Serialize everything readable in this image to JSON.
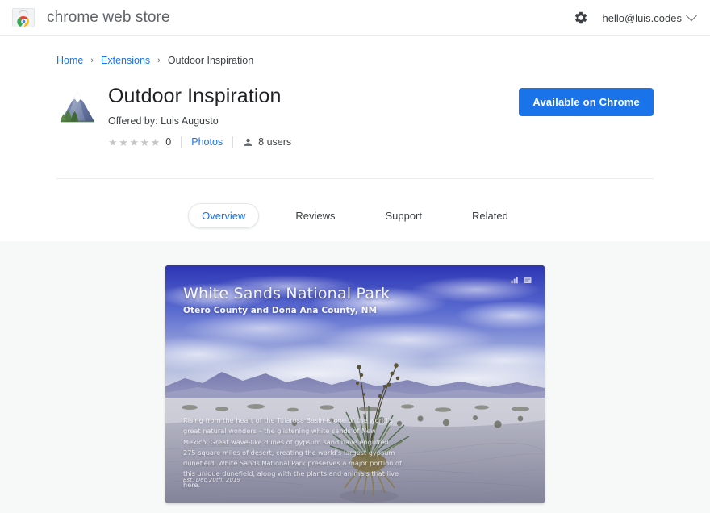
{
  "header": {
    "brand_title": "chrome web store",
    "logo_icon": "chrome-web-store-logo",
    "gear_icon": "gear-icon",
    "account_email": "hello@luis.codes",
    "chevron_icon": "chevron-down-icon"
  },
  "breadcrumb": {
    "items": [
      {
        "label": "Home",
        "link": true
      },
      {
        "label": "Extensions",
        "link": true
      },
      {
        "label": "Outdoor Inspiration",
        "link": false
      }
    ],
    "separator": "›"
  },
  "app": {
    "icon": "mountain-icon",
    "title": "Outdoor Inspiration",
    "offered_by": "Offered by: Luis Augusto",
    "rating_value": "0",
    "star_glyph": "★",
    "star_count": 5,
    "photos_label": "Photos",
    "users_icon": "person-icon",
    "users_label": "8 users",
    "cta_label": "Available on Chrome"
  },
  "tabs": [
    {
      "label": "Overview",
      "active": true
    },
    {
      "label": "Reviews",
      "active": false
    },
    {
      "label": "Support",
      "active": false
    },
    {
      "label": "Related",
      "active": false
    }
  ],
  "screenshot": {
    "title": "White Sands National Park",
    "subtitle": "Otero County and Doña Ana County, NM",
    "body": "Rising from the heart of the Tularosa Basin is one of the world's great natural wonders – the glistening white sands of New Mexico. Great wave-like dunes of gypsum sand have engulfed 275 square miles of desert, creating the world's largest gypsum dunefield. White Sands National Park preserves a major portion of this unique dunefield, along with the plants and animals that live here.",
    "established": "Est. Dec 20th, 2019",
    "icon_left": "chart-icon",
    "icon_right": "card-icon"
  },
  "colors": {
    "accent_blue": "#1a73e8",
    "text_primary": "#202124",
    "text_secondary": "#5f6368",
    "section_bg": "#f7f8f8",
    "star_gray": "#c6c6c6"
  }
}
